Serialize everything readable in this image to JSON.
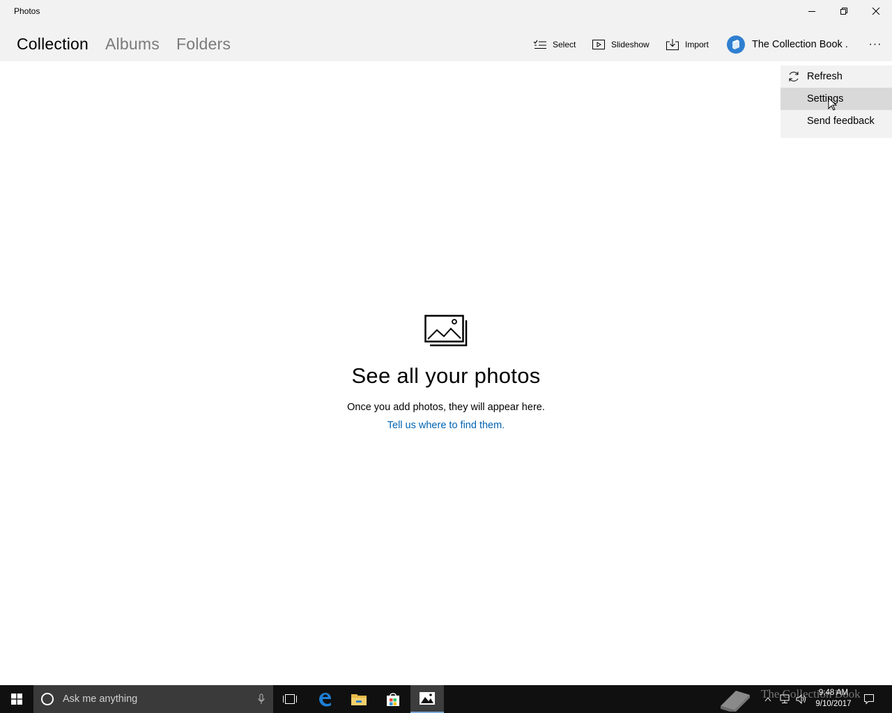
{
  "window": {
    "title": "Photos"
  },
  "tabs": [
    {
      "label": "Collection",
      "active": true
    },
    {
      "label": "Albums",
      "active": false
    },
    {
      "label": "Folders",
      "active": false
    }
  ],
  "toolbar": {
    "select_label": "Select",
    "slideshow_label": "Slideshow",
    "import_label": "Import",
    "account_name": "The Collection Book .",
    "more_label": "···"
  },
  "menu": {
    "items": [
      {
        "label": "Refresh"
      },
      {
        "label": "Settings"
      },
      {
        "label": "Send feedback"
      }
    ]
  },
  "empty_state": {
    "title": "See all your photos",
    "subtitle": "Once you add photos, they will appear here.",
    "link": "Tell us where to find them."
  },
  "taskbar": {
    "search_placeholder": "Ask me anything",
    "time": "9:48 AM",
    "date": "9/10/2017",
    "watermark": "The Collection Book"
  },
  "colors": {
    "chrome": "#f2f2f2",
    "accent_link": "#0063b1",
    "menu_hover": "#d9d9d9",
    "taskbar": "#101010"
  }
}
